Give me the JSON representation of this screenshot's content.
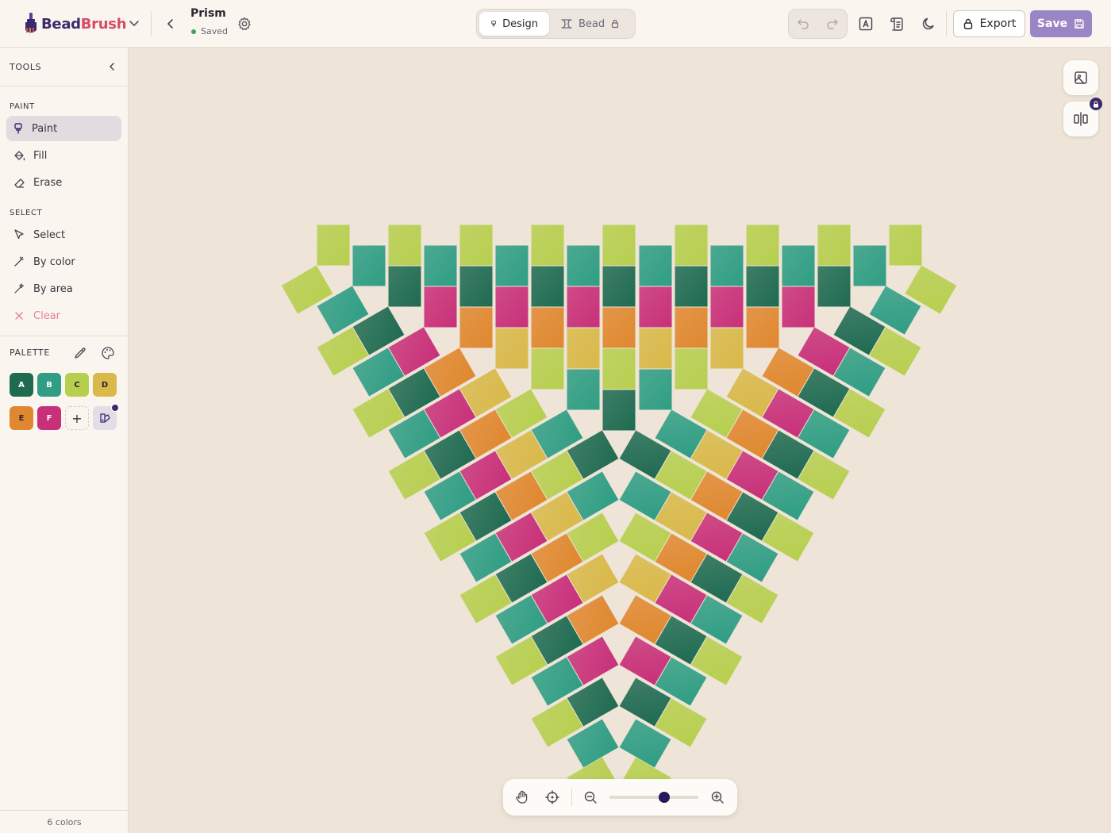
{
  "app": {
    "name_part1": "Bead",
    "name_part2": "Brush"
  },
  "document": {
    "title": "Prism",
    "status": "Saved"
  },
  "modes": [
    {
      "label": "Design",
      "active": true
    },
    {
      "label": "Bead",
      "active": false,
      "locked": true
    }
  ],
  "toolbar": {
    "export_label": "Export",
    "save_label": "Save"
  },
  "sidebar": {
    "title": "TOOLS",
    "paint_section": "PAINT",
    "paint_tools": [
      {
        "label": "Paint",
        "icon": "brush-icon",
        "active": true
      },
      {
        "label": "Fill",
        "icon": "bucket-icon"
      },
      {
        "label": "Erase",
        "icon": "eraser-icon"
      }
    ],
    "select_section": "SELECT",
    "select_tools": [
      {
        "label": "Select",
        "icon": "cursor-icon"
      },
      {
        "label": "By color",
        "icon": "wand-icon"
      },
      {
        "label": "By area",
        "icon": "sparkle-wand-icon"
      },
      {
        "label": "Clear",
        "icon": "close-icon"
      }
    ],
    "palette_title": "PALETTE",
    "palette": [
      {
        "key": "A",
        "color": "#1f6b52"
      },
      {
        "key": "B",
        "color": "#2f9e84"
      },
      {
        "key": "C",
        "color": "#b7cf4f"
      },
      {
        "key": "D",
        "color": "#d9b94a"
      },
      {
        "key": "E",
        "color": "#e0882f"
      },
      {
        "key": "F",
        "color": "#c83079"
      }
    ],
    "add_label": "+",
    "footer": "6 colors"
  },
  "zoom": {
    "level": 0.62
  }
}
